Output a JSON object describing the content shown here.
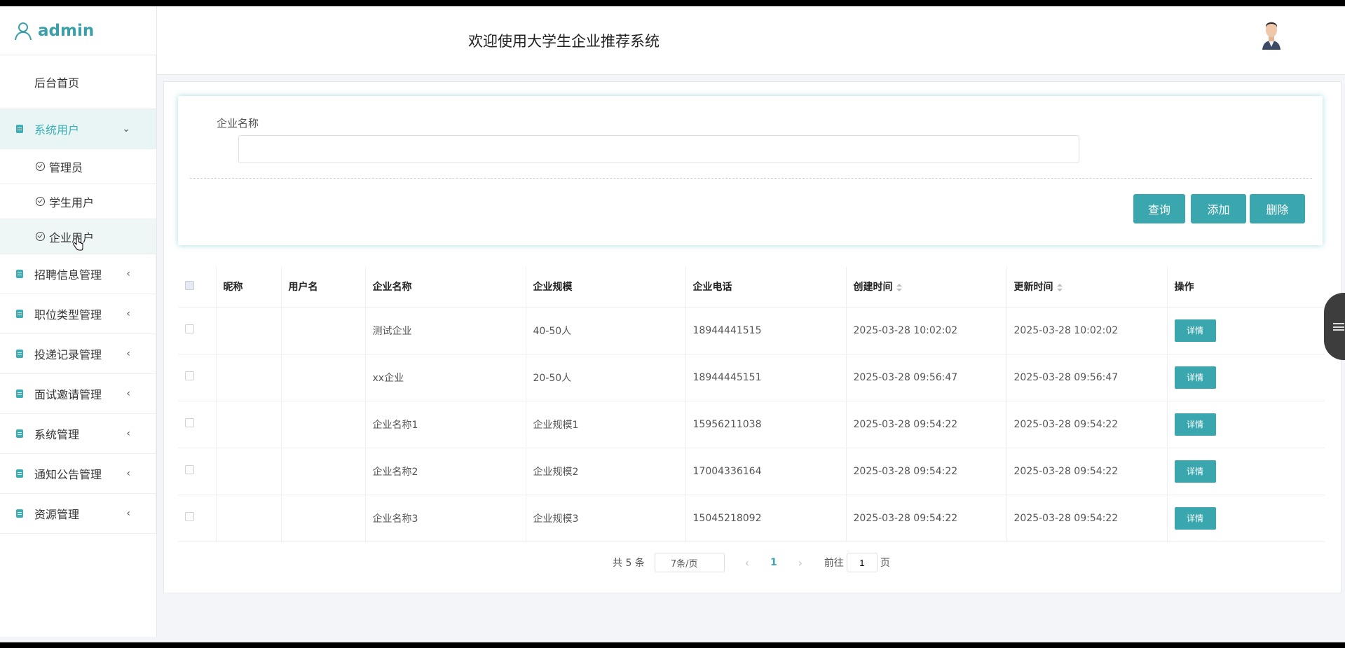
{
  "sidebar": {
    "brand": "admin",
    "home": "后台首页",
    "system_users": {
      "label": "系统用户",
      "sub": [
        "管理员",
        "学生用户",
        "企业用户"
      ]
    },
    "menus": [
      "招聘信息管理",
      "职位类型管理",
      "投递记录管理",
      "面试邀请管理",
      "系统管理",
      "通知公告管理",
      "资源管理"
    ]
  },
  "header": {
    "title": "欢迎使用大学生企业推荐系统"
  },
  "search": {
    "label": "企业名称",
    "value": "",
    "placeholder": ""
  },
  "buttons": {
    "query": "查询",
    "add": "添加",
    "delete": "删除"
  },
  "table": {
    "headers": {
      "nickname": "昵称",
      "username": "用户名",
      "company_name": "企业名称",
      "company_scale": "企业规模",
      "company_phone": "企业电话",
      "created": "创建时间",
      "updated": "更新时间",
      "actions": "操作"
    },
    "rows": [
      {
        "nickname": "",
        "username": "",
        "company_name": "测试企业",
        "company_scale": "40-50人",
        "company_phone": "18944441515",
        "created": "2025-03-28 10:02:02",
        "updated": "2025-03-28 10:02:02",
        "action": "详情"
      },
      {
        "nickname": "",
        "username": "",
        "company_name": "xx企业",
        "company_scale": "20-50人",
        "company_phone": "18944445151",
        "created": "2025-03-28 09:56:47",
        "updated": "2025-03-28 09:56:47",
        "action": "详情"
      },
      {
        "nickname": "",
        "username": "",
        "company_name": "企业名称1",
        "company_scale": "企业规模1",
        "company_phone": "15956211038",
        "created": "2025-03-28 09:54:22",
        "updated": "2025-03-28 09:54:22",
        "action": "详情"
      },
      {
        "nickname": "",
        "username": "",
        "company_name": "企业名称2",
        "company_scale": "企业规模2",
        "company_phone": "17004336164",
        "created": "2025-03-28 09:54:22",
        "updated": "2025-03-28 09:54:22",
        "action": "详情"
      },
      {
        "nickname": "",
        "username": "",
        "company_name": "企业名称3",
        "company_scale": "企业规模3",
        "company_phone": "15045218092",
        "created": "2025-03-28 09:54:22",
        "updated": "2025-03-28 09:54:22",
        "action": "详情"
      }
    ]
  },
  "pagination": {
    "total": "共 5 条",
    "page_size": "7条/页",
    "prev": "‹",
    "current_page": "1",
    "next": "›",
    "goto_prefix": "前往",
    "goto_value": "1",
    "goto_suffix": "页"
  },
  "colors": {
    "accent": "#3aa6ad",
    "brand_text": "#3b9fa8"
  }
}
